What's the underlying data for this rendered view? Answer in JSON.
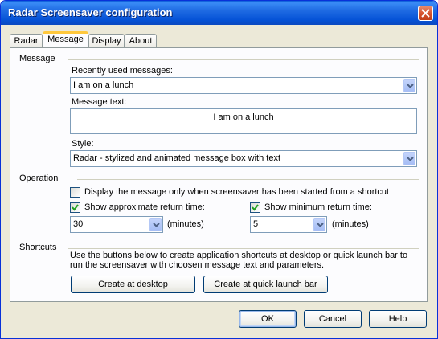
{
  "window": {
    "title": "Radar Screensaver configuration"
  },
  "tabs": [
    "Radar",
    "Message",
    "Display",
    "About"
  ],
  "message": {
    "group_label": "Message",
    "recent_label": "Recently used messages:",
    "recent_value": "I am on a lunch",
    "text_label": "Message text:",
    "text_value": "I am on a lunch",
    "style_label": "Style:",
    "style_value": "Radar - stylized and animated message box with text"
  },
  "operation": {
    "group_label": "Operation",
    "shortcut_only_label": "Display the message only when screensaver has been started from a shortcut",
    "shortcut_only_checked": false,
    "approx_label": "Show approximate return time:",
    "approx_checked": true,
    "approx_value": "30",
    "approx_unit": "(minutes)",
    "min_label": "Show minimum return time:",
    "min_checked": true,
    "min_value": "5",
    "min_unit": "(minutes)"
  },
  "shortcuts": {
    "group_label": "Shortcuts",
    "description_line1": "Use the buttons below to create application shortcuts at desktop or quick launch bar to",
    "description_line2": "run the screensaver with choosen message text and parameters.",
    "desktop_button": "Create at desktop",
    "quicklaunch_button": "Create at quick launch bar"
  },
  "footer": {
    "ok": "OK",
    "cancel": "Cancel",
    "help": "Help"
  },
  "colors": {
    "titlebar": "#0a5ad8",
    "dialog_bg": "#ece9d8",
    "panel_bg": "#fcfcfe",
    "active_tab": "#ffc83c",
    "close_button": "#d4502c"
  }
}
